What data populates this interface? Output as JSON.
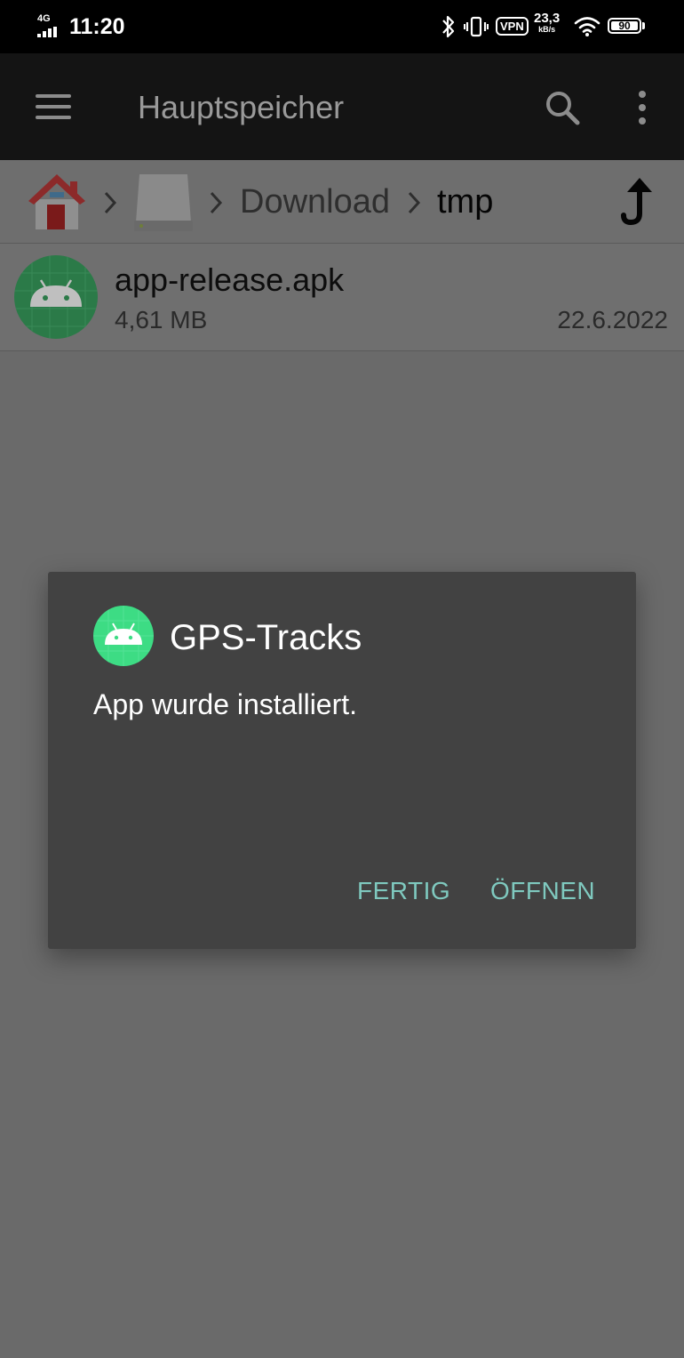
{
  "status_bar": {
    "network": "4G",
    "time": "11:20",
    "vpn": "VPN",
    "speed_value": "23,3",
    "speed_unit": "kB/s",
    "battery": "90"
  },
  "app_bar": {
    "title": "Hauptspeicher",
    "icons": [
      "menu-icon",
      "search-icon",
      "more-vert-icon"
    ]
  },
  "breadcrumb": {
    "items": [
      "Download",
      "tmp"
    ],
    "icons": [
      "home-icon",
      "storage-icon",
      "up-arrow-icon"
    ]
  },
  "files": [
    {
      "name": "app-release.apk",
      "size": "4,61 MB",
      "date": "22.6.2022",
      "icon": "android-apk-icon"
    }
  ],
  "dialog": {
    "title": "GPS-Tracks",
    "message": "App wurde installiert.",
    "buttons": {
      "done": "FERTIG",
      "open": "ÖFFNEN"
    },
    "accent_color": "#7fc9bf"
  }
}
